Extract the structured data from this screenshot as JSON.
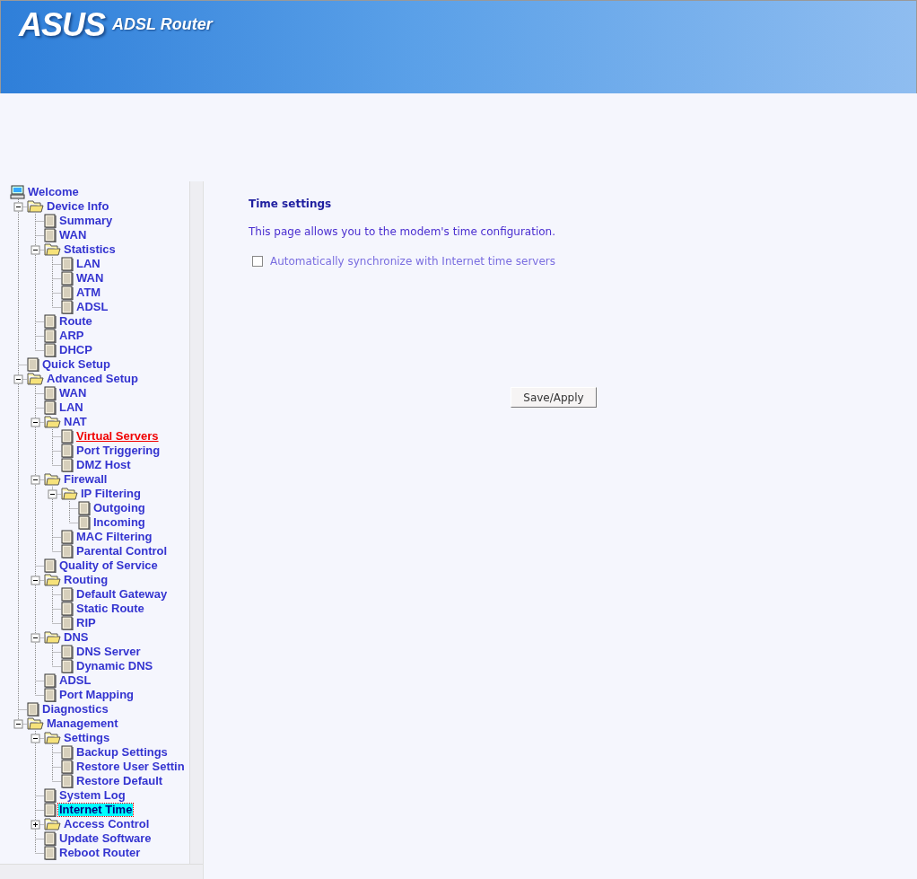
{
  "header": {
    "brand": "ASUS",
    "product": "ADSL Router"
  },
  "tree": {
    "label": "Welcome",
    "kind": "computer",
    "selected": false,
    "hovered": false,
    "children": [
      {
        "label": "Device Info",
        "kind": "folder",
        "expanded": true,
        "selected": false,
        "hovered": false,
        "children": [
          {
            "label": "Summary",
            "kind": "page",
            "selected": false,
            "hovered": false
          },
          {
            "label": "WAN",
            "kind": "page",
            "selected": false,
            "hovered": false
          },
          {
            "label": "Statistics",
            "kind": "folder",
            "expanded": true,
            "selected": false,
            "hovered": false,
            "children": [
              {
                "label": "LAN",
                "kind": "page",
                "selected": false,
                "hovered": false
              },
              {
                "label": "WAN",
                "kind": "page",
                "selected": false,
                "hovered": false
              },
              {
                "label": "ATM",
                "kind": "page",
                "selected": false,
                "hovered": false
              },
              {
                "label": "ADSL",
                "kind": "page",
                "selected": false,
                "hovered": false
              }
            ]
          },
          {
            "label": "Route",
            "kind": "page",
            "selected": false,
            "hovered": false
          },
          {
            "label": "ARP",
            "kind": "page",
            "selected": false,
            "hovered": false
          },
          {
            "label": "DHCP",
            "kind": "page",
            "selected": false,
            "hovered": false
          }
        ]
      },
      {
        "label": "Quick Setup",
        "kind": "page",
        "selected": false,
        "hovered": false
      },
      {
        "label": "Advanced Setup",
        "kind": "folder",
        "expanded": true,
        "selected": false,
        "hovered": false,
        "children": [
          {
            "label": "WAN",
            "kind": "page",
            "selected": false,
            "hovered": false
          },
          {
            "label": "LAN",
            "kind": "page",
            "selected": false,
            "hovered": false
          },
          {
            "label": "NAT",
            "kind": "folder",
            "expanded": true,
            "selected": false,
            "hovered": false,
            "children": [
              {
                "label": "Virtual Servers",
                "kind": "page",
                "selected": false,
                "hovered": true
              },
              {
                "label": "Port Triggering",
                "kind": "page",
                "selected": false,
                "hovered": false
              },
              {
                "label": "DMZ Host",
                "kind": "page",
                "selected": false,
                "hovered": false
              }
            ]
          },
          {
            "label": "Firewall",
            "kind": "folder",
            "expanded": true,
            "selected": false,
            "hovered": false,
            "children": [
              {
                "label": "IP Filtering",
                "kind": "folder",
                "expanded": true,
                "selected": false,
                "hovered": false,
                "children": [
                  {
                    "label": "Outgoing",
                    "kind": "page",
                    "selected": false,
                    "hovered": false
                  },
                  {
                    "label": "Incoming",
                    "kind": "page",
                    "selected": false,
                    "hovered": false
                  }
                ]
              },
              {
                "label": "MAC Filtering",
                "kind": "page",
                "selected": false,
                "hovered": false
              },
              {
                "label": "Parental Control",
                "kind": "page",
                "selected": false,
                "hovered": false
              }
            ]
          },
          {
            "label": "Quality of Service",
            "kind": "page",
            "selected": false,
            "hovered": false
          },
          {
            "label": "Routing",
            "kind": "folder",
            "expanded": true,
            "selected": false,
            "hovered": false,
            "children": [
              {
                "label": "Default Gateway",
                "kind": "page",
                "selected": false,
                "hovered": false
              },
              {
                "label": "Static Route",
                "kind": "page",
                "selected": false,
                "hovered": false
              },
              {
                "label": "RIP",
                "kind": "page",
                "selected": false,
                "hovered": false
              }
            ]
          },
          {
            "label": "DNS",
            "kind": "folder",
            "expanded": true,
            "selected": false,
            "hovered": false,
            "children": [
              {
                "label": "DNS Server",
                "kind": "page",
                "selected": false,
                "hovered": false
              },
              {
                "label": "Dynamic DNS",
                "kind": "page",
                "selected": false,
                "hovered": false
              }
            ]
          },
          {
            "label": "ADSL",
            "kind": "page",
            "selected": false,
            "hovered": false
          },
          {
            "label": "Port Mapping",
            "kind": "page",
            "selected": false,
            "hovered": false
          }
        ]
      },
      {
        "label": "Diagnostics",
        "kind": "page",
        "selected": false,
        "hovered": false
      },
      {
        "label": "Management",
        "kind": "folder",
        "expanded": true,
        "selected": false,
        "hovered": false,
        "children": [
          {
            "label": "Settings",
            "kind": "folder",
            "expanded": true,
            "selected": false,
            "hovered": false,
            "children": [
              {
                "label": "Backup Settings",
                "kind": "page",
                "selected": false,
                "hovered": false
              },
              {
                "label": "Restore User Settin",
                "kind": "page",
                "selected": false,
                "hovered": false
              },
              {
                "label": "Restore Default",
                "kind": "page",
                "selected": false,
                "hovered": false
              }
            ]
          },
          {
            "label": "System Log",
            "kind": "page",
            "selected": false,
            "hovered": false
          },
          {
            "label": "Internet Time",
            "kind": "page",
            "selected": true,
            "hovered": false
          },
          {
            "label": "Access Control",
            "kind": "folder",
            "expanded": false,
            "selected": false,
            "hovered": false
          },
          {
            "label": "Update Software",
            "kind": "page",
            "selected": false,
            "hovered": false
          },
          {
            "label": "Reboot Router",
            "kind": "page",
            "selected": false,
            "hovered": false
          }
        ]
      }
    ]
  },
  "content": {
    "title": "Time settings",
    "description": "This page allows you to the modem's time configuration.",
    "sync": {
      "label": "Automatically synchronize with Internet time servers",
      "checked": false
    },
    "button": "Save/Apply"
  }
}
